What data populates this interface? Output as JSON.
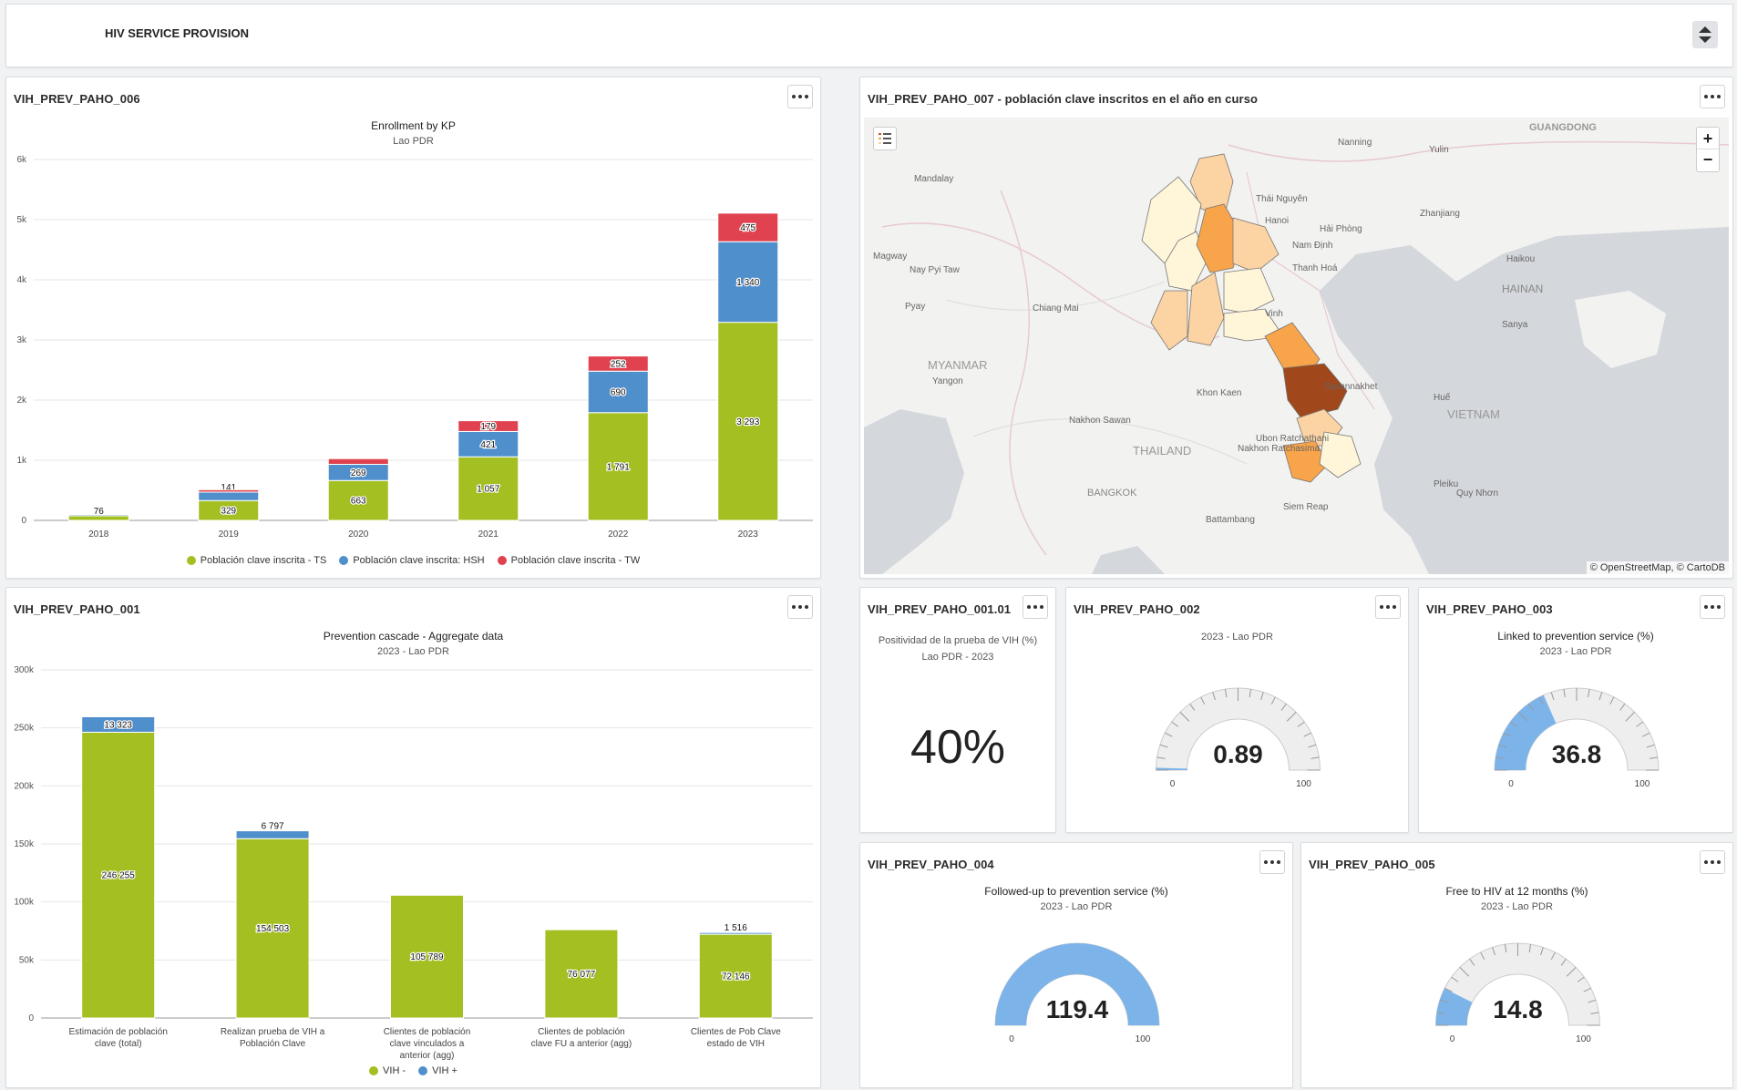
{
  "header": {
    "title": "HIV SERVICE PROVISION"
  },
  "colors": {
    "ts": "#a3bf21",
    "hsh": "#4f8fcc",
    "tw": "#e0424f",
    "gauge_fill": "#7cb4ea",
    "gauge_bg": "#eeeeee"
  },
  "panels": {
    "p006": {
      "title": "VIH_PREV_PAHO_006",
      "chart_title": "Enrollment by KP",
      "chart_subtitle": "Lao PDR"
    },
    "p007": {
      "title": "VIH_PREV_PAHO_007 - población clave inscritos en el año en curso",
      "attribution": "© OpenStreetMap, © CartoDB"
    },
    "p001": {
      "title": "VIH_PREV_PAHO_001",
      "chart_title": "Prevention cascade - Aggregate data",
      "chart_subtitle": "2023 - Lao PDR"
    },
    "p00101": {
      "title": "VIH_PREV_PAHO_001.01",
      "line1": "Positividad de la prueba de VIH (%)",
      "line2": "Lao PDR - 2023",
      "value": "40%"
    },
    "p002": {
      "title": "VIH_PREV_PAHO_002",
      "subtitle": "2023 - Lao PDR",
      "value": "0.89",
      "min": "0",
      "max": "100"
    },
    "p003": {
      "title": "VIH_PREV_PAHO_003",
      "chart_title": "Linked to prevention service (%)",
      "subtitle": "2023 - Lao PDR",
      "value": "36.8",
      "min": "0",
      "max": "100"
    },
    "p004": {
      "title": "VIH_PREV_PAHO_004",
      "chart_title": "Followed-up to prevention service (%)",
      "subtitle": "2023 - Lao PDR",
      "value": "119.4",
      "min": "0",
      "max": "100"
    },
    "p005": {
      "title": "VIH_PREV_PAHO_005",
      "chart_title": "Free to HIV at 12 months (%)",
      "subtitle": "2023 - Lao PDR",
      "value": "14.8",
      "min": "0",
      "max": "100"
    }
  },
  "map": {
    "labels": [
      "GUANGDONG",
      "Nanning",
      "Yulin",
      "Mandalay",
      "Thái Nguyên",
      "Hanoi",
      "Hải Phòng",
      "Zhanjiang",
      "Magway",
      "Nay Pyi Taw",
      "Nam Định",
      "Thanh Hoá",
      "Haikou",
      "HAINAN",
      "Pyay",
      "Chiang Mai",
      "Vinh",
      "Sanya",
      "MYANMAR",
      "Yangon",
      "Khon Kaen",
      "Savannakhet",
      "Huế",
      "VIETNAM",
      "Nakhon Sawan",
      "Ubon Ratchathani",
      "THAILAND",
      "Nakhon Ratchasima",
      "BANGKOK",
      "Pleiku",
      "Quy Nhơn",
      "Siem Reap",
      "Battambang"
    ]
  },
  "chart_data": [
    {
      "type": "bar",
      "title": "Enrollment by KP",
      "subtitle": "Lao PDR",
      "categories": [
        "2018",
        "2019",
        "2020",
        "2021",
        "2022",
        "2023"
      ],
      "series": [
        {
          "name": "Población clave inscrita - TS",
          "values": [
            76,
            329,
            663,
            1057,
            1791,
            3293
          ],
          "labels": [
            "76",
            "329",
            "663",
            "1 057",
            "1 791",
            "3 293"
          ]
        },
        {
          "name": "Población clave inscrita: HSH",
          "values": [
            20,
            141,
            269,
            421,
            690,
            1340
          ],
          "labels": [
            "",
            "141",
            "269",
            "421",
            "690",
            "1 340"
          ]
        },
        {
          "name": "Población clave inscrita - TW",
          "values": [
            0,
            40,
            95,
            179,
            252,
            475
          ],
          "labels": [
            "",
            "",
            "",
            "179",
            "252",
            "475"
          ]
        }
      ],
      "ylim": [
        0,
        6000
      ],
      "yticks": [
        "0",
        "1k",
        "2k",
        "3k",
        "4k",
        "5k",
        "6k"
      ],
      "stacked": true,
      "legend": "bottom"
    },
    {
      "type": "bar",
      "title": "Prevention cascade - Aggregate data",
      "subtitle": "2023 - Lao PDR",
      "categories": [
        "Estimación de población clave (total)",
        "Realizan prueba de VIH a Población Clave",
        "Clientes de población clave vinculados a anterior (agg)",
        "Clientes de población clave FU a anterior (agg)",
        "Clientes de Pob Clave estado de VIH"
      ],
      "series": [
        {
          "name": "VIH -",
          "values": [
            246255,
            154503,
            105789,
            76077,
            72146
          ],
          "labels": [
            "246 255",
            "154 503",
            "105 789",
            "76 077",
            "72 146"
          ]
        },
        {
          "name": "VIH +",
          "values": [
            13323,
            6797,
            0,
            0,
            1516
          ],
          "labels": [
            "13 323",
            "6 797",
            "",
            "",
            "1 516"
          ]
        }
      ],
      "ylim": [
        0,
        300000
      ],
      "yticks": [
        "0",
        "50k",
        "100k",
        "150k",
        "200k",
        "250k",
        "300k"
      ],
      "stacked": true,
      "legend": "bottom"
    }
  ]
}
